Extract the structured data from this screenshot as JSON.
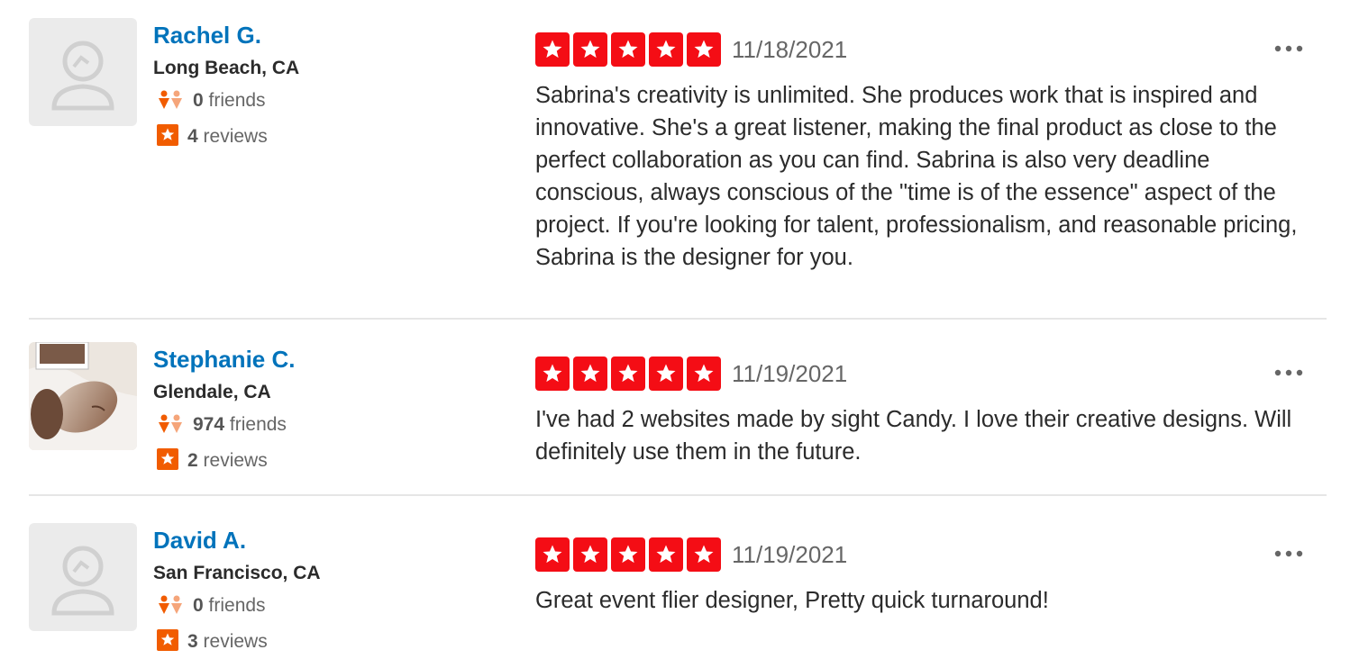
{
  "reviews": [
    {
      "name": "Rachel G.",
      "location": "Long Beach, CA",
      "friends_count": "0",
      "friends_label": "friends",
      "reviews_count": "4",
      "reviews_label": "reviews",
      "rating": 5,
      "date": "11/18/2021",
      "avatar": "default-user-avatar",
      "text": "Sabrina's creativity is unlimited.  She produces work that is inspired and innovative.  She's a great listener, making the final product as close to the perfect collaboration as you can find.  Sabrina is also very deadline conscious, always conscious of the \"time is of the essence\" aspect of the project.  If you're looking for talent, professionalism, and reasonable pricing, Sabrina is the designer for you."
    },
    {
      "name": "Stephanie C.",
      "location": "Glendale, CA",
      "friends_count": "974",
      "friends_label": "friends",
      "reviews_count": "2",
      "reviews_label": "reviews",
      "rating": 5,
      "date": "11/19/2021",
      "avatar": "user-photo",
      "text": "I've had 2 websites made by sight Candy. I love their creative designs. Will definitely use them in the future."
    },
    {
      "name": "David A.",
      "location": "San Francisco, CA",
      "friends_count": "0",
      "friends_label": "friends",
      "reviews_count": "3",
      "reviews_label": "reviews",
      "rating": 5,
      "date": "11/19/2021",
      "avatar": "default-user-avatar",
      "text": "Great event flier designer, Pretty quick turnaround!"
    }
  ],
  "colors": {
    "star_red": "#f40d15",
    "name_blue": "#0073bb",
    "badge_orange": "#f15c00"
  },
  "icons": {
    "friends": "friends-icon",
    "reviews": "review-star-icon",
    "more": "more-options-icon"
  }
}
